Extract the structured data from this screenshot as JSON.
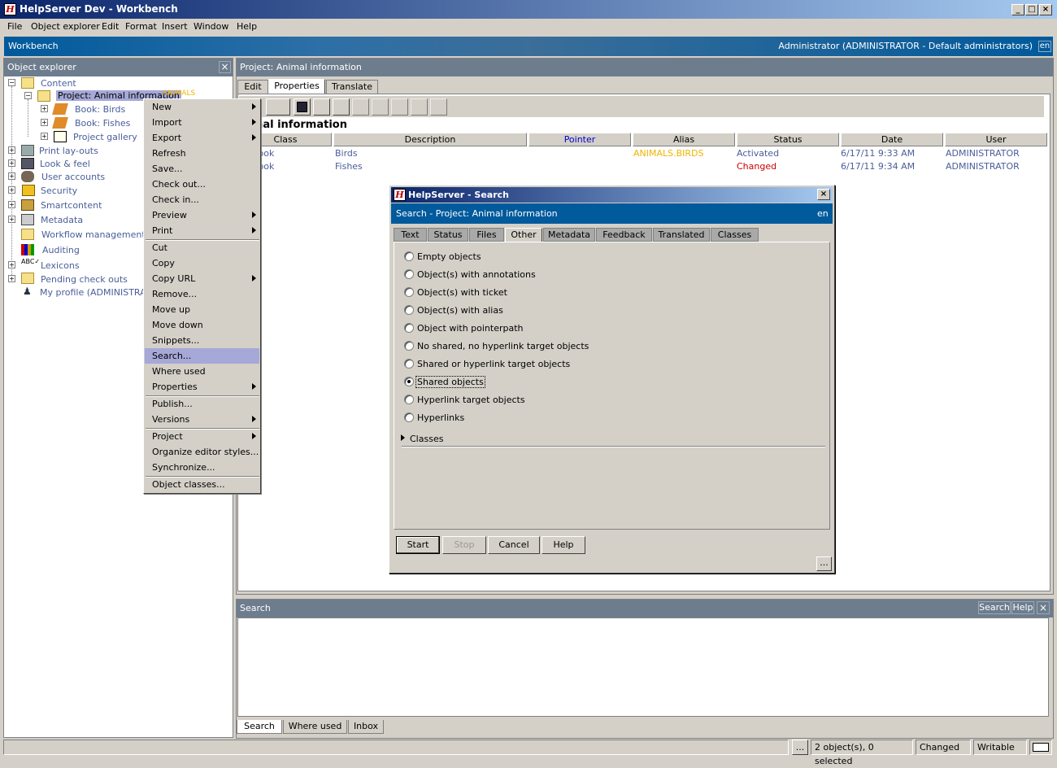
{
  "window": {
    "title": "HelpServer Dev - Workbench",
    "icon_letter": "H"
  },
  "menu": [
    "File",
    "Object explorer",
    "Edit",
    "Format",
    "Insert",
    "Window",
    "Help"
  ],
  "workbench": {
    "label": "Workbench",
    "user": "Administrator (ADMINISTRATOR - Default administrators)",
    "lang": "en"
  },
  "explorer": {
    "title": "Object explorer",
    "tree": {
      "content": "Content",
      "project": "Project: Animal information",
      "project_alias": "ANIMALS",
      "book_birds": "Book: Birds",
      "book_fishes": "Book: Fishes",
      "gallery": "Project gallery",
      "print_layouts": "Print lay-outs",
      "look_feel": "Look & feel",
      "user_accounts": "User accounts",
      "security": "Security",
      "smartcontent": "Smartcontent",
      "metadata": "Metadata",
      "workflow": "Workflow management",
      "auditing": "Auditing",
      "lexicons": "Lexicons",
      "pending": "Pending check outs",
      "profile": "My profile (ADMINISTRATOR)"
    }
  },
  "context_menu": {
    "new": "New",
    "import": "Import",
    "export": "Export",
    "refresh": "Refresh",
    "save": "Save...",
    "check_out": "Check out...",
    "check_in": "Check in...",
    "preview": "Preview",
    "print": "Print",
    "cut": "Cut",
    "copy": "Copy",
    "copy_url": "Copy URL",
    "remove": "Remove...",
    "move_up": "Move up",
    "move_down": "Move down",
    "snippets": "Snippets...",
    "search": "Search...",
    "where_used": "Where used",
    "properties": "Properties",
    "publish": "Publish...",
    "versions": "Versions",
    "project": "Project",
    "organize": "Organize editor styles...",
    "synchronize": "Synchronize...",
    "object_classes": "Object classes..."
  },
  "project": {
    "title": "Project: Animal information",
    "tabs": [
      "Edit",
      "Properties",
      "Translate"
    ],
    "heading": "Animal information",
    "columns": [
      "Class",
      "Description",
      "Pointer",
      "Alias",
      "Status",
      "Date",
      "User"
    ],
    "rows": [
      {
        "class": "Book",
        "description": "Birds",
        "pointer": "",
        "alias": "ANIMALS.BIRDS",
        "status": "Activated",
        "date": "6/17/11 9:33 AM",
        "user": "ADMINISTRATOR"
      },
      {
        "class": "Book",
        "description": "Fishes",
        "pointer": "",
        "alias": "",
        "status": "Changed",
        "date": "6/17/11 9:34 AM",
        "user": "ADMINISTRATOR"
      }
    ]
  },
  "dialog": {
    "title": "HelpServer - Search",
    "header": "Search - Project: Animal information",
    "lang": "en",
    "tabs": [
      "Text",
      "Status",
      "Files",
      "Other",
      "Metadata",
      "Feedback",
      "Translated",
      "Classes"
    ],
    "options": [
      "Empty objects",
      "Object(s) with annotations",
      "Object(s) with ticket",
      "Object(s) with alias",
      "Object with pointerpath",
      "No shared, no hyperlink target objects",
      "Shared or hyperlink target objects",
      "Shared objects",
      "Hyperlink target objects",
      "Hyperlinks"
    ],
    "selected": "Shared objects",
    "classes": "Classes",
    "buttons": {
      "start": "Start",
      "stop": "Stop",
      "cancel": "Cancel",
      "help": "Help",
      "more": "..."
    }
  },
  "search_panel": {
    "title": "Search",
    "search_btn": "Search",
    "help_btn": "Help",
    "tabs": [
      "Search",
      "Where used",
      "Inbox"
    ]
  },
  "status": {
    "more": "...",
    "count": "2 object(s), 0 selected",
    "state": "Changed",
    "mode": "Writable"
  },
  "colors": {
    "accent": "#005a9c",
    "panel_header": "#6d7d8e",
    "selection": "#a6a8d8",
    "link": "#4a5e9a",
    "alias": "#f0b400",
    "changed": "#cc0000"
  }
}
